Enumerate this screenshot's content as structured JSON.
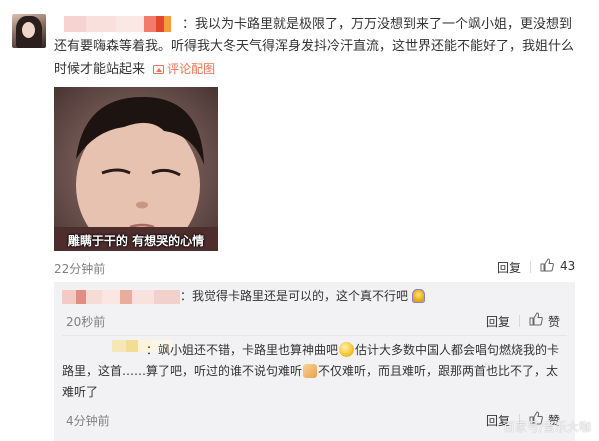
{
  "comment": {
    "text": "：我以为卡路里就是极限了，万万没想到来了一个飒小姐，更没想到还有要嗨森等着我。听得我大冬天气得浑身发抖冷汗直流，这世界还能不能好了，我姐什么时候才能站起来",
    "view_pic_label": "评论配图",
    "image_caption": "雕瞒于干的 有想哭的心情",
    "time": "22分钟前",
    "reply_label": "回复",
    "like_count": "43"
  },
  "replies": [
    {
      "text": "：我觉得卡路里还是可以的，这个真不行吧",
      "time": "20秒前",
      "reply_label": "回复",
      "like_label": "赞"
    },
    {
      "text_a": "：飒小姐还不错，卡路里也算神曲吧",
      "text_b": "估计大多数中国人都会唱句燃烧我的卡路里，这首……算了吧，听过的谁不说句难听",
      "text_c": "不仅难听，而且难听，跟那两首也比不了，太难听了",
      "time": "4分钟前",
      "reply_label": "回复",
      "like_label": "赞"
    }
  ],
  "watermark": "百家号/音乐大咖",
  "colors": {
    "link": "#eb7350",
    "meta": "#808080",
    "reply_bg": "#f2f2f5"
  },
  "icons": [
    "thumb-up-icon",
    "picture-icon",
    "smile-emoji-icon",
    "thumb-emoji-icon",
    "bell-emoji-icon"
  ]
}
